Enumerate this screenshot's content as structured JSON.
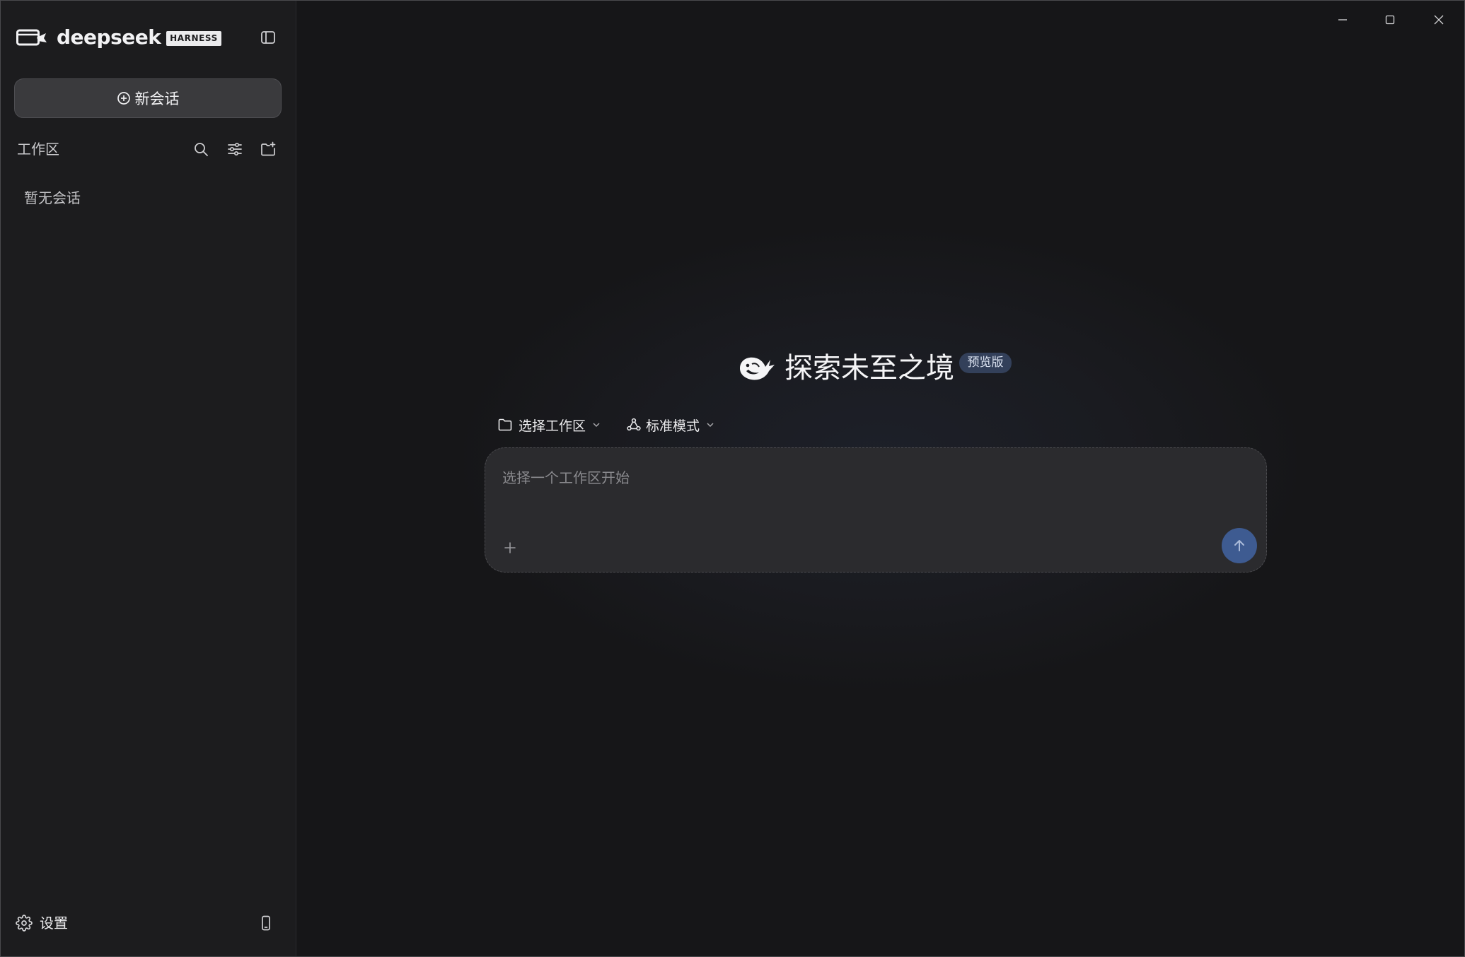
{
  "window": {
    "controls": {
      "minimize_icon": "minimize-icon",
      "maximize_icon": "maximize-icon",
      "close_icon": "close-icon"
    }
  },
  "sidebar": {
    "brand": {
      "logo_icon": "deepseek-harness-logo-icon",
      "name": "deepseek",
      "badge": "HARNESS"
    },
    "toggle_icon": "sidebar-toggle-icon",
    "new_chat": {
      "icon": "plus-circle-icon",
      "label": "新会话"
    },
    "workspace": {
      "label": "工作区",
      "actions": [
        "search-icon",
        "filter-sliders-icon",
        "new-folder-icon"
      ]
    },
    "empty_text": "暂无会话",
    "footer": {
      "settings_icon": "gear-icon",
      "settings_label": "设置",
      "mobile_icon": "phone-icon"
    }
  },
  "main": {
    "hero": {
      "icon": "whale-icon",
      "title": "探索未至之境",
      "badge": "预览版"
    },
    "toolbar": {
      "workspace_select": {
        "icon": "folder-icon",
        "label": "选择工作区",
        "chevron": "chevron-down-icon"
      },
      "mode_select": {
        "icon": "mode-nodes-icon",
        "label": "标准模式",
        "chevron": "chevron-down-icon"
      }
    },
    "composer": {
      "placeholder": "选择一个工作区开始",
      "attach_icon": "plus-icon",
      "send_icon": "arrow-up-icon"
    }
  },
  "colors": {
    "sidebar_bg": "#1c1c1e",
    "main_bg": "#161618",
    "new_chat_bg": "#3a3a3d",
    "composer_bg": "#2b2b2e",
    "send_button": "#3e5b91",
    "badge_bg": "#33405a"
  }
}
